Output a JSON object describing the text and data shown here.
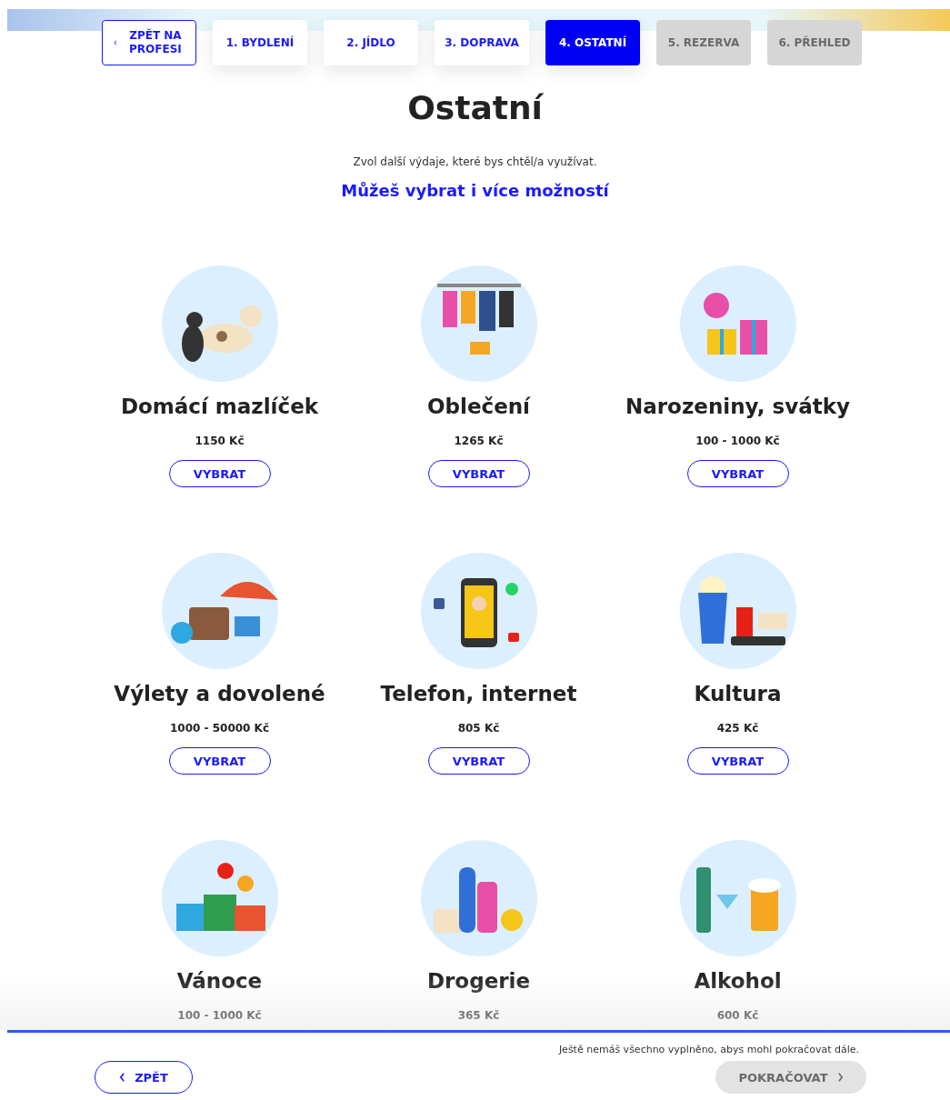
{
  "nav": {
    "back": "ZPĚT NA PROFESI",
    "steps": [
      {
        "label": "1. BYDLENÍ",
        "selected": false,
        "disabled": false
      },
      {
        "label": "2. JÍDLO",
        "selected": false,
        "disabled": false
      },
      {
        "label": "3. DOPRAVA",
        "selected": false,
        "disabled": false
      },
      {
        "label": "4. OSTATNÍ",
        "selected": true,
        "disabled": false
      },
      {
        "label": "5. REZERVA",
        "selected": false,
        "disabled": true
      },
      {
        "label": "6. PŘEHLED",
        "selected": false,
        "disabled": true
      }
    ]
  },
  "title": "Ostatní",
  "intro": "Zvol další výdaje, které bys chtěl/a využívat.",
  "hint": "Můžeš vybrat i více možností",
  "items": [
    {
      "name": "Domácí mazlíček",
      "price": "1150 Kč",
      "button": "VYBRAT"
    },
    {
      "name": "Oblečení",
      "price": "1265 Kč",
      "button": "VYBRAT"
    },
    {
      "name": "Narozeniny, svátky",
      "price": "100 - 1000 Kč",
      "button": "VYBRAT"
    },
    {
      "name": "Výlety a dovolené",
      "price": "1000 - 50000 Kč",
      "button": "VYBRAT"
    },
    {
      "name": "Telefon, internet",
      "price": "805 Kč",
      "button": "VYBRAT"
    },
    {
      "name": "Kultura",
      "price": "425 Kč",
      "button": "VYBRAT"
    },
    {
      "name": "Vánoce",
      "price": "100 - 1000 Kč"
    },
    {
      "name": "Drogerie",
      "price": "365 Kč"
    },
    {
      "name": "Alkohol",
      "price": "600 Kč"
    }
  ],
  "footer": {
    "message": "Ještě nemáš všechno vyplněno, abys mohl pokračovat dále.",
    "back": "ZPĚT",
    "next": "POKRAČOVAT",
    "next_disabled": true
  }
}
